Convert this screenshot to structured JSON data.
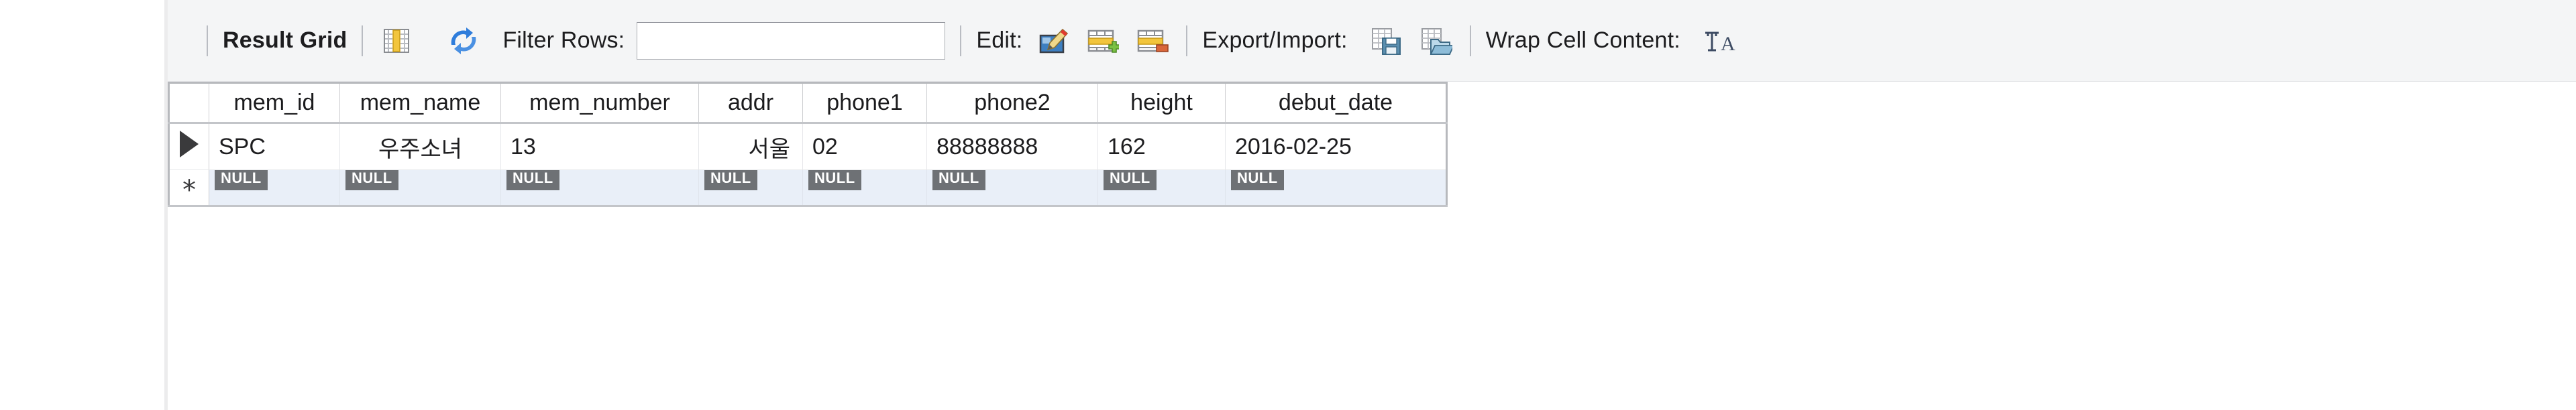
{
  "toolbar": {
    "result_grid_label": "Result Grid",
    "grid_columns_icon": "grid-columns-icon",
    "refresh_icon": "refresh-icon",
    "filter_rows_label": "Filter Rows:",
    "filter_rows_value": "",
    "filter_rows_placeholder": "",
    "edit_label": "Edit:",
    "edit_icon": "pencil-edit-icon",
    "insert_row_icon": "insert-row-icon",
    "delete_row_icon": "delete-row-icon",
    "export_import_label": "Export/Import:",
    "export_icon": "export-recordset-icon",
    "import_icon": "import-recordset-icon",
    "wrap_cell_content_label": "Wrap Cell Content:",
    "wrap_cell_icon": "wrap-text-icon"
  },
  "colors": {
    "toolbar_bg": "#f4f5f6",
    "grid_border": "#b7b9bd",
    "null_badge_bg": "#6e7175",
    "new_row_bg": "#e9eff8",
    "accent_blue": "#2f7ddb",
    "accent_yellow": "#f2c53d",
    "accent_green": "#7ac142",
    "accent_orange": "#d9663a"
  },
  "grid": {
    "columns": [
      "mem_id",
      "mem_name",
      "mem_number",
      "addr",
      "phone1",
      "phone2",
      "height",
      "debut_date"
    ],
    "rows": [
      {
        "marker": "▶",
        "cells": [
          "SPC",
          "우주소녀",
          "13",
          "서울",
          "02",
          "88888888",
          "162",
          "2016-02-25"
        ]
      }
    ],
    "new_row": {
      "marker": "*",
      "cells": [
        "NULL",
        "NULL",
        "NULL",
        "NULL",
        "NULL",
        "NULL",
        "NULL",
        "NULL"
      ]
    }
  }
}
